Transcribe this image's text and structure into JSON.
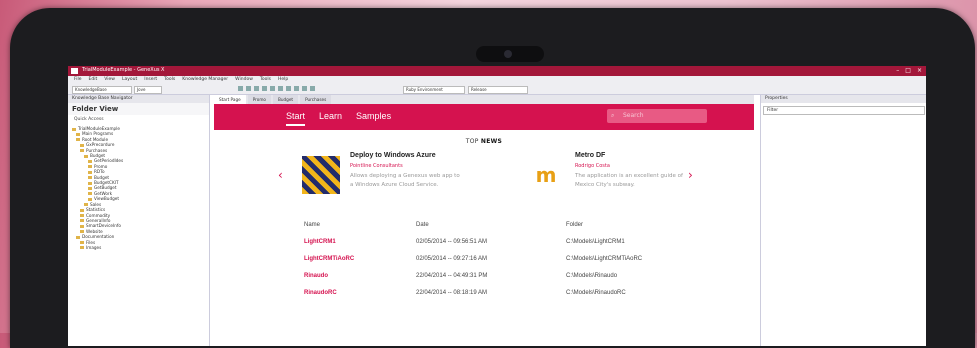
{
  "window": {
    "title": "TrialModuleExample - GeneXus X"
  },
  "menu": [
    "File",
    "Edit",
    "View",
    "Layout",
    "Insert",
    "Tools",
    "Knowledge Manager",
    "Window",
    "Tools",
    "Help"
  ],
  "toolbar": {
    "env_label": "KnowledgeBase",
    "env_value": "Jove",
    "search_value": "Ruby Environment",
    "platform_value": "Release"
  },
  "left_panel": {
    "header": "Knowledge Base Navigator",
    "title": "Folder View",
    "quick_access": "Quick Access",
    "tree": [
      "TrialModuleExample",
      "Main Programs",
      "Root Module",
      "GxPrecordure",
      "Purchases",
      "Budget",
      "GetPeriodIdes",
      "Promo",
      "RDTo",
      "Budget",
      "BudgetCKIT",
      "GetBudget",
      "GetWork",
      "ViewBudget",
      "Sales",
      "Statistics",
      "Commodity",
      "GeneralInfo",
      "SmartDeviceInfo",
      "Website",
      "Documentation",
      "Files",
      "Images"
    ]
  },
  "doc_tabs": [
    "Start Page",
    "Promo",
    "Budget",
    "Purchases"
  ],
  "start_page": {
    "tabs": [
      "Start",
      "Learn",
      "Samples"
    ],
    "search_placeholder": "Search",
    "top_news_prefix": "TOP",
    "top_news_bold": "NEWS",
    "news": [
      {
        "title": "Deploy to Windows Azure",
        "author": "Pointline Consultants",
        "desc": "Allows deploying a Genexus web app to a Windows Azure Cloud Service."
      },
      {
        "title": "Metro DF",
        "author": "Rodrigo Costa",
        "desc": "The application is an excellent guide of Mexico City's subway."
      }
    ],
    "table": {
      "headers": [
        "Name",
        "Date",
        "Folder"
      ],
      "rows": [
        [
          "LightCRM1",
          "02/05/2014 -- 09:56:51 AM",
          "C:\\Models\\LightCRM1"
        ],
        [
          "LightCRMTiAoRC",
          "02/05/2014 -- 09:27:16 AM",
          "C:\\Models\\LightCRMTiAoRC"
        ],
        [
          "Rinaudo",
          "22/04/2014 -- 04:49:31 PM",
          "C:\\Models\\Rinaudo"
        ],
        [
          "RinaudoRC",
          "22/04/2014 -- 08:18:19 AM",
          "C:\\Models\\RinaudoRC"
        ]
      ]
    }
  },
  "right_panel": {
    "header": "Properties",
    "filter": "Filter"
  },
  "icons": {
    "azure": "azure-thumbnail",
    "metro": "metro-logo-icon",
    "prev": "chevron-left-icon",
    "next": "chevron-right-icon"
  },
  "colors": {
    "accent": "#d5124f",
    "titlebar": "#a3173a"
  }
}
